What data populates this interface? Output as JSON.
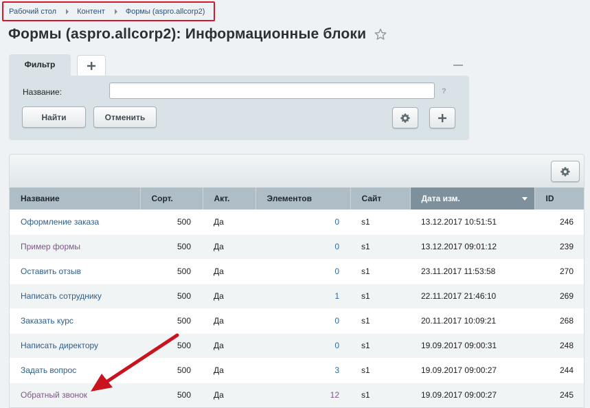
{
  "breadcrumb": {
    "items": [
      "Рабочий стол",
      "Контент",
      "Формы (aspro.allcorp2)"
    ]
  },
  "page": {
    "title": "Формы (aspro.allcorp2): Информационные блоки"
  },
  "filter": {
    "tab_label": "Фильтр",
    "name_label": "Название:",
    "name_value": "",
    "help": "?",
    "find_label": "Найти",
    "cancel_label": "Отменить"
  },
  "table": {
    "columns": [
      "Название",
      "Сорт.",
      "Акт.",
      "Элементов",
      "Сайт",
      "Дата изм.",
      "ID"
    ],
    "sorted_column": "Дата изм.",
    "rows": [
      {
        "name": "Оформление заказа",
        "sort": "500",
        "active": "Да",
        "elements": "0",
        "site": "s1",
        "date": "13.12.2017 10:51:51",
        "id": "246"
      },
      {
        "name": "Пример формы",
        "sort": "500",
        "active": "Да",
        "elements": "0",
        "site": "s1",
        "date": "13.12.2017 09:01:12",
        "id": "239"
      },
      {
        "name": "Оставить отзыв",
        "sort": "500",
        "active": "Да",
        "elements": "0",
        "site": "s1",
        "date": "23.11.2017 11:53:58",
        "id": "270"
      },
      {
        "name": "Написать сотруднику",
        "sort": "500",
        "active": "Да",
        "elements": "1",
        "site": "s1",
        "date": "22.11.2017 21:46:10",
        "id": "269"
      },
      {
        "name": "Заказать курс",
        "sort": "500",
        "active": "Да",
        "elements": "0",
        "site": "s1",
        "date": "20.11.2017 10:09:21",
        "id": "268"
      },
      {
        "name": "Написать директору",
        "sort": "500",
        "active": "Да",
        "elements": "0",
        "site": "s1",
        "date": "19.09.2017 09:00:31",
        "id": "248"
      },
      {
        "name": "Задать вопрос",
        "sort": "500",
        "active": "Да",
        "elements": "3",
        "site": "s1",
        "date": "19.09.2017 09:00:27",
        "id": "244"
      },
      {
        "name": "Обратный звонок",
        "sort": "500",
        "active": "Да",
        "elements": "12",
        "site": "s1",
        "date": "19.09.2017 09:00:27",
        "id": "245"
      }
    ]
  },
  "colors": {
    "link": "#2d5d8b",
    "visited_link": "#7c5586",
    "highlight": "#d8172a",
    "header": "#aebdc6",
    "sorted_header": "#7e909c"
  },
  "icons": [
    "chevron-right-icon",
    "star-icon",
    "plus-icon",
    "minus-icon",
    "gear-icon",
    "sort-desc-icon",
    "red-arrow-annotation"
  ]
}
